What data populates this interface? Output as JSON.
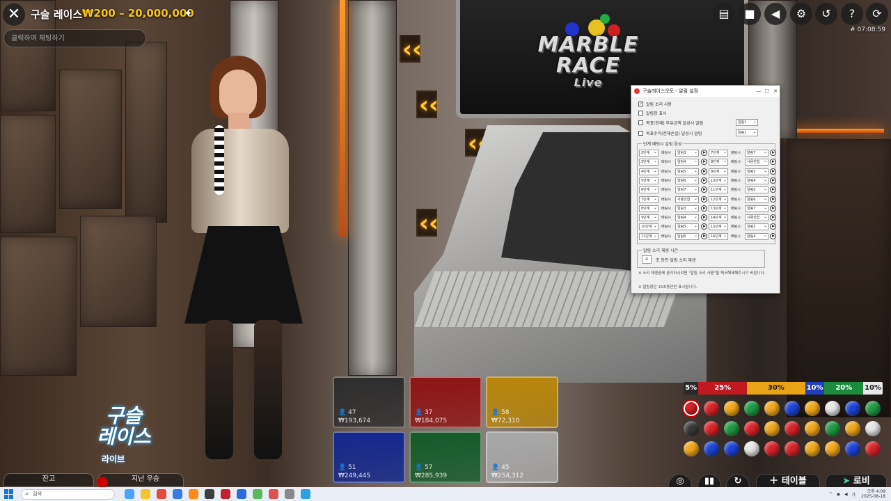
{
  "header": {
    "title": "구슬 레이스",
    "bet_range": "₩200 – 20,000,000",
    "chat_placeholder": "클릭하여 채팅하기",
    "round_id": "# 07:08:59"
  },
  "top_icons": [
    "chat-icon",
    "video-icon",
    "sound-icon",
    "settings-icon",
    "history-icon",
    "help-icon",
    "reload-icon"
  ],
  "stream_logo": {
    "line1": "MARBLE",
    "line2": "RACE",
    "line3": "Live"
  },
  "dialog": {
    "title": "구슬레이스오토 - 알림 설정",
    "checkboxes": [
      {
        "label": "알림 소리 사용",
        "checked": true
      },
      {
        "label": "알림창 표시",
        "checked": false
      },
      {
        "label": "목표(현재) 부유금액 달성시 알림",
        "checked": false,
        "select": "알림1"
      },
      {
        "label": "목표수익(전체손실) 달성시 알림",
        "checked": false,
        "select": "알림1"
      }
    ],
    "group_title": "단계 배팅시 알림 음성",
    "rows": [
      {
        "step": "2단계",
        "label": "배팅시",
        "sound": "알림3",
        "step2": "7단계",
        "label2": "배팅시",
        "sound2": "알림7"
      },
      {
        "step": "3단계",
        "label": "배팅시",
        "sound": "알림4",
        "step2": "8단계",
        "label2": "배팅시",
        "sound2": "사용안함"
      },
      {
        "step": "4단계",
        "label": "배팅시",
        "sound": "알림5",
        "step2": "9단계",
        "label2": "배팅시",
        "sound2": "알림3"
      },
      {
        "step": "5단계",
        "label": "배팅시",
        "sound": "알림6",
        "step2": "10단계",
        "label2": "배팅시",
        "sound2": "알림4"
      },
      {
        "step": "6단계",
        "label": "배팅시",
        "sound": "알림7",
        "step2": "11단계",
        "label2": "배팅시",
        "sound2": "알림5"
      },
      {
        "step": "7단계",
        "label": "배팅시",
        "sound": "사용안함",
        "step2": "12단계",
        "label2": "배팅시",
        "sound2": "알림6"
      },
      {
        "step": "8단계",
        "label": "배팅시",
        "sound": "알림3",
        "step2": "13단계",
        "label2": "배팅시",
        "sound2": "알림7"
      },
      {
        "step": "9단계",
        "label": "배팅시",
        "sound": "알림4",
        "step2": "14단계",
        "label2": "배팅시",
        "sound2": "사용안함"
      },
      {
        "step": "10단계",
        "label": "배팅시",
        "sound": "알림5",
        "step2": "15단계",
        "label2": "배팅시",
        "sound2": "알림3"
      },
      {
        "step": "11단계",
        "label": "배팅시",
        "sound": "알림6",
        "step2": "16단계",
        "label2": "배팅시",
        "sound2": "알림4"
      }
    ],
    "repeat_group_title": "알림 소리 재생 시간",
    "repeat_seconds": "4",
    "repeat_label": "초 동안 알림 소리 재생",
    "note1": "※ 소리 재생중에 중지하시려면 \"알림 소리 사용\"을 체크해제해주시기 바랍니다.",
    "note2": "※ 알림창은 15초동안만 표시됩니다."
  },
  "tiles": [
    {
      "color": "black",
      "hex": "#2e2e2e",
      "count": "47",
      "amount": "₩193,674"
    },
    {
      "color": "red",
      "hex": "#8e1515",
      "count": "37",
      "amount": "₩184,075"
    },
    {
      "color": "yellow",
      "hex": "#b8860b",
      "count": "58",
      "amount": "₩72,310"
    },
    {
      "color": "blue",
      "hex": "#14288e",
      "count": "51",
      "amount": "₩249,445"
    },
    {
      "color": "green",
      "hex": "#155c2a",
      "count": "57",
      "amount": "₩285,939"
    },
    {
      "color": "white",
      "hex": "#a8a8a8",
      "count": "45",
      "amount": "₩254,312"
    }
  ],
  "stats": [
    {
      "label": "5%",
      "hex": "#2a2a2a",
      "text": "#ffffff",
      "value": 5
    },
    {
      "label": "25%",
      "hex": "#c0191f",
      "text": "#ffffff",
      "value": 25
    },
    {
      "label": "30%",
      "hex": "#e8a317",
      "text": "#1a1a1a",
      "value": 30
    },
    {
      "label": "10%",
      "hex": "#1f3fbf",
      "text": "#ffffff",
      "value": 10
    },
    {
      "label": "20%",
      "hex": "#1d8b3e",
      "text": "#ffffff",
      "value": 20
    },
    {
      "label": "10%",
      "hex": "#e8e8e8",
      "text": "#1a1a1a",
      "value": 10
    }
  ],
  "history": [
    [
      "red",
      "red",
      "yellow",
      "green",
      "yellow",
      "blue",
      "yellow",
      "white",
      "blue",
      "green"
    ],
    [
      "black",
      "red",
      "green",
      "red",
      "yellow",
      "red",
      "yellow",
      "green",
      "yellow",
      "white"
    ],
    [
      "yellow",
      "blue",
      "blue",
      "white",
      "red",
      "red",
      "yellow",
      "yellow",
      "blue",
      "red"
    ]
  ],
  "colors": {
    "red": "#d8232a",
    "yellow": "#f0a71a",
    "green": "#1f9a45",
    "blue": "#1e43d6",
    "white": "#e6e6e6",
    "black": "#3a3a3a"
  },
  "brand": {
    "line1": "구슬",
    "line2": "레이스",
    "sub": "라이브"
  },
  "bottom": {
    "balance_label": "잔고",
    "last_win_label": "지난 우승"
  },
  "bottom_right": {
    "table_label": "테이블",
    "lobby_label": "로비"
  },
  "taskbar": {
    "search_placeholder": "검색",
    "tray_lang": "가",
    "time": "오후 4:09",
    "date": "2025-08-18"
  }
}
